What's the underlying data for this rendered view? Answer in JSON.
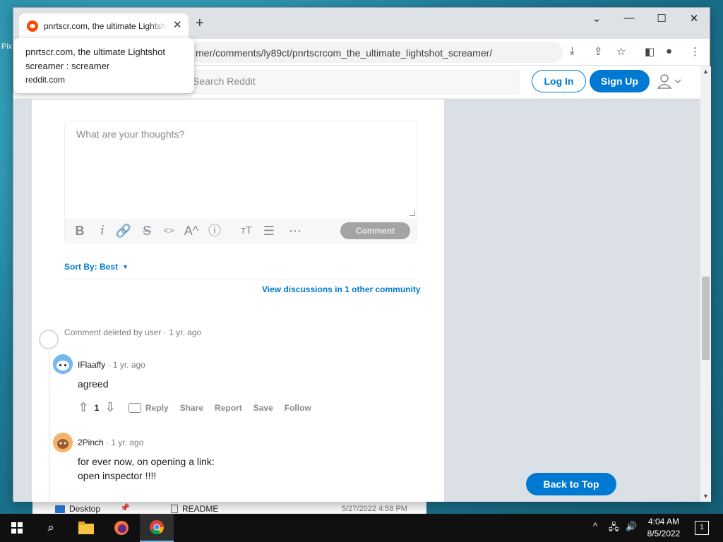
{
  "desktop": {
    "label": "Pix"
  },
  "browser": {
    "tab_title": "pnrtscr.com, the ultimate Lightshot screamer : screamer",
    "new_tab": "+",
    "url": "mer/comments/ly89ct/pnrtscrcom_the_ultimate_lightshot_screamer/",
    "hover_card": {
      "title": "pnrtscr.com, the ultimate Lightshot screamer : screamer",
      "domain": "reddit.com"
    }
  },
  "reddit": {
    "search_placeholder": "Search Reddit",
    "login_label": "Log In",
    "signup_label": "Sign Up",
    "comment_placeholder": "What are your thoughts?",
    "comment_button": "Comment",
    "sort_label": "Sort By: Best",
    "view_discussions": "View discussions in 1 other community",
    "back_to_top": "Back to Top",
    "comments": [
      {
        "author": "",
        "meta": "Comment deleted by user · 1 yr. ago"
      },
      {
        "author": "IFlaaffy",
        "age": " · 1 yr. ago",
        "body": "agreed",
        "score": "1",
        "actions": [
          "Reply",
          "Share",
          "Report",
          "Save",
          "Follow"
        ]
      },
      {
        "author": "2Pinch",
        "age": " · 1 yr. ago",
        "body_line1": "for ever now, on opening a link:",
        "body_line2": "open inspector !!!!"
      }
    ]
  },
  "explorer": {
    "desktop_label": "Desktop",
    "file_name": "README",
    "file_date": "5/27/2022 4:58 PM"
  },
  "taskbar": {
    "time": "4:04 AM",
    "date": "8/5/2022",
    "notifications": "1"
  },
  "colors": {
    "reddit_blue": "#0079d3",
    "orangered": "#ff4500",
    "page_bg": "#dae0e6"
  }
}
